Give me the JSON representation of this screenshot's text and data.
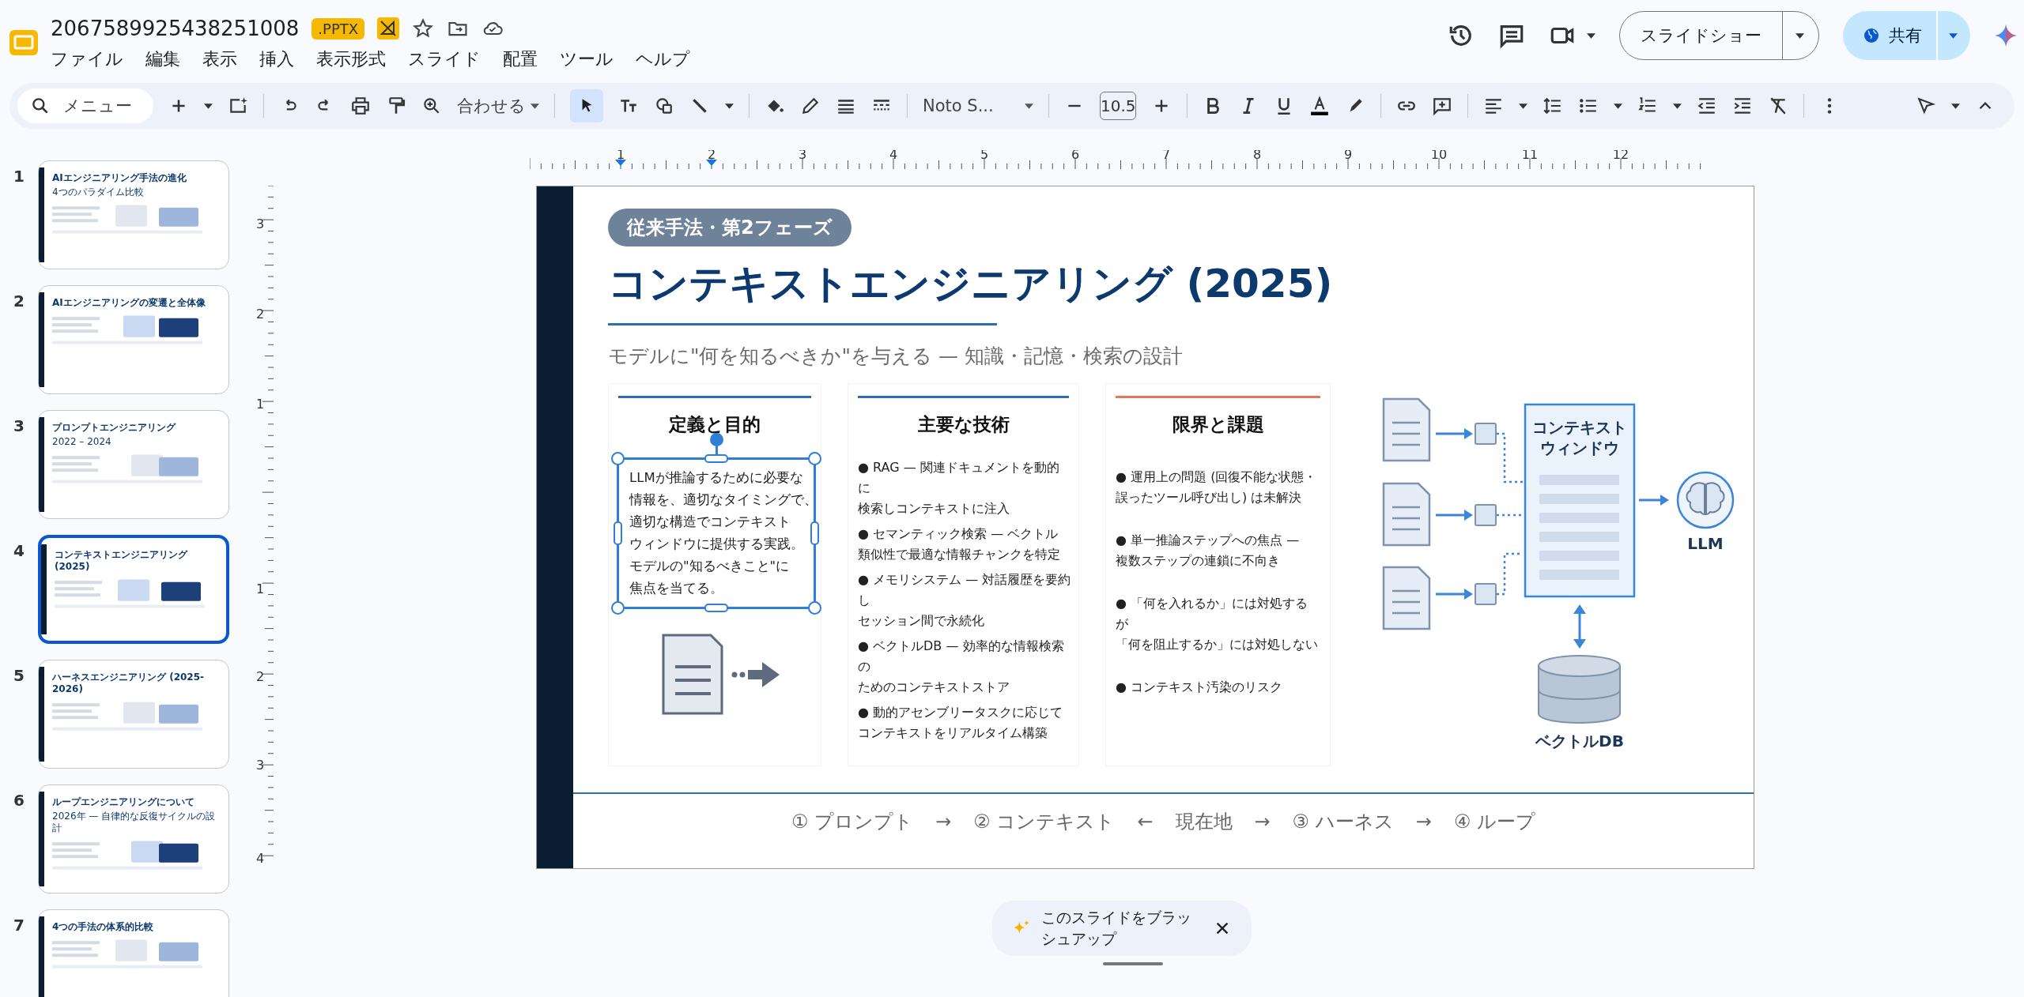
{
  "app": {
    "file_name": "2067589925438251008",
    "badge": ".PPTX",
    "menu": [
      "ファイル",
      "編集",
      "表示",
      "挿入",
      "表示形式",
      "スライド",
      "配置",
      "ツール",
      "ヘルプ"
    ]
  },
  "header": {
    "slideshow_button": "スライドショー",
    "share_button": "共有"
  },
  "toolbar": {
    "search_placeholder": "メニュー",
    "zoom": "合わせる",
    "font": "Noto S...",
    "font_size": "10.5",
    "select_tool_selected": true
  },
  "ruler": {
    "horizontal": [
      "1",
      "2",
      "3",
      "4",
      "5",
      "6",
      "7",
      "8",
      "9",
      "10",
      "11",
      "12"
    ],
    "vertical": [
      "3",
      "2",
      "1",
      "1",
      "2",
      "3",
      "4"
    ]
  },
  "thumbnails": [
    {
      "number": "1",
      "title": "AIエンジニアリング手法の進化",
      "title_2": "4つのパラダイム比較",
      "selected": false
    },
    {
      "number": "2",
      "title": "AIエンジニアリングの変遷と全体像",
      "selected": false
    },
    {
      "number": "3",
      "title": "プロンプトエンジニアリング",
      "title_2": "2022 – 2024",
      "selected": false
    },
    {
      "number": "4",
      "title": "コンテキストエンジニアリング (2025)",
      "selected": true
    },
    {
      "number": "5",
      "title": "ハーネスエンジニアリング (2025-2026)",
      "selected": false
    },
    {
      "number": "6",
      "title": "ループエンジニアリングについて",
      "title_2": "2026年 — 自律的な反復サイクルの設計",
      "selected": false
    },
    {
      "number": "7",
      "title": "4つの手法の体系的比較",
      "selected": false
    }
  ],
  "slide": {
    "tag": "従来手法・第2フェーズ",
    "title": "コンテキストエンジニアリング (2025)",
    "subtitle": "モデルに\"何を知るべきか\"を与える — 知識・記憶・検索の設計",
    "cards": [
      {
        "kind": "paragraph",
        "heading": "定義と目的",
        "color": "#2f6db5",
        "selected": true,
        "text": [
          "LLMが推論するために必要な",
          "情報を、適切なタイミングで、",
          "適切な構造でコンテキスト",
          "ウィンドウに提供する実践。",
          "モデルの\"知るべきこと\"に",
          "焦点を当てる。"
        ]
      },
      {
        "kind": "bullets",
        "heading": "主要な技術",
        "color": "#2f6db5",
        "bullets": [
          [
            "● RAG — 関連ドキュメントを動的",
            "に",
            "検索しコンテキストに注入"
          ],
          [
            "● セマンティック検索 — ベクトル",
            "類似性で最適な情報チャンクを特定"
          ],
          [
            "● メモリシステム — 対話履歴を要約",
            "し",
            "セッション間で永続化"
          ],
          [
            "● ベクトルDB — 効率的な情報検索",
            "の",
            "ためのコンテキストストア"
          ],
          [
            "● 動的アセンブリータスクに応じて",
            "コンテキストをリアルタイム構築"
          ]
        ]
      },
      {
        "kind": "bullets",
        "heading": "限界と課題",
        "color": "#e0795c",
        "bullets": [
          [
            "● 運用上の問題 (回復不能な状態・",
            "誤ったツール呼び出し) は未解決"
          ],
          [
            "● 単一推論ステップへの焦点 —",
            "複数ステップの連鎖に不向き"
          ],
          [
            "● 「何を入れるか」には対処する",
            "が",
            "「何を阻止するか」には対処しない"
          ],
          [
            "● コンテキスト汚染のリスク"
          ]
        ]
      }
    ],
    "diagram": {
      "window_label": [
        "コンテキスト",
        "ウィンドウ"
      ],
      "llm_label": "LLM",
      "db_label": "ベクトルDB"
    },
    "footer_steps": [
      "① プロンプト",
      "→",
      "② コンテキスト",
      "←",
      "現在地",
      "→",
      "③ ハーネス",
      "→",
      "④ ループ"
    ]
  },
  "toast": {
    "text": [
      "このスライドをブラッ",
      "シュアップ"
    ]
  }
}
